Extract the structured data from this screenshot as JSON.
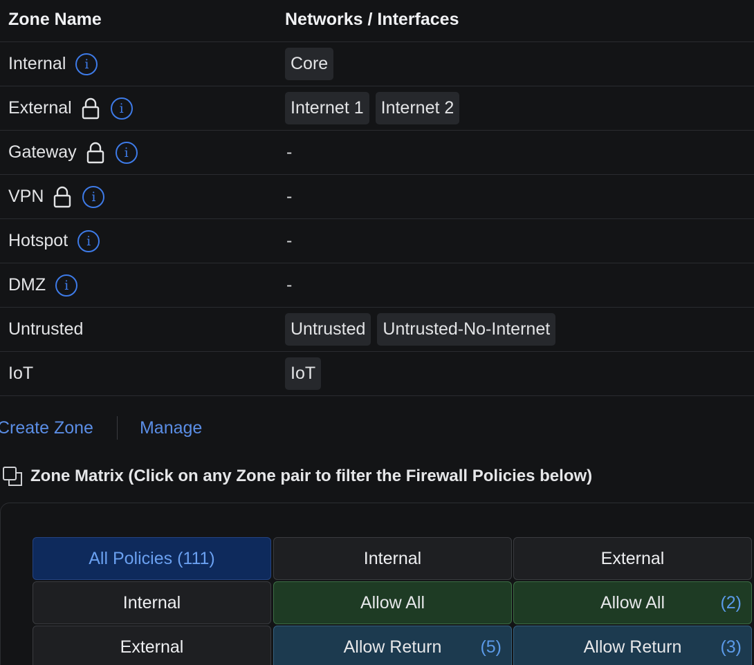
{
  "zone_table": {
    "headers": {
      "zone_name": "Zone Name",
      "networks": "Networks / Interfaces"
    },
    "rows": [
      {
        "name": "Internal",
        "locked": false,
        "info": true,
        "networks": [
          "Core"
        ]
      },
      {
        "name": "External",
        "locked": true,
        "info": true,
        "networks": [
          "Internet 1",
          "Internet 2"
        ]
      },
      {
        "name": "Gateway",
        "locked": true,
        "info": true,
        "networks": [],
        "empty": "-"
      },
      {
        "name": "VPN",
        "locked": true,
        "info": true,
        "networks": [],
        "empty": "-"
      },
      {
        "name": "Hotspot",
        "locked": false,
        "info": true,
        "networks": [],
        "empty": "-"
      },
      {
        "name": "DMZ",
        "locked": false,
        "info": true,
        "networks": [],
        "empty": "-"
      },
      {
        "name": "Untrusted",
        "locked": false,
        "info": false,
        "networks": [
          "Untrusted",
          "Untrusted-No-Internet"
        ]
      },
      {
        "name": "IoT",
        "locked": false,
        "info": false,
        "networks": [
          "IoT"
        ]
      }
    ]
  },
  "actions": {
    "create_zone": "Create Zone",
    "manage": "Manage"
  },
  "matrix": {
    "title": "Zone Matrix (Click on any Zone pair to filter the Firewall Policies below)",
    "all_policies": "All Policies (111)",
    "columns": [
      "Internal",
      "External"
    ],
    "rows": [
      {
        "label": "Internal",
        "cells": [
          {
            "text": "Allow All",
            "count": "",
            "kind": "green"
          },
          {
            "text": "Allow All",
            "count": "(2)",
            "kind": "green"
          }
        ]
      },
      {
        "label": "External",
        "cells": [
          {
            "text": "Allow Return",
            "count": "(5)",
            "kind": "blue"
          },
          {
            "text": "Allow Return",
            "count": "(3)",
            "kind": "blue"
          }
        ]
      }
    ]
  },
  "icons": {
    "info": "info-icon",
    "lock": "lock-icon",
    "matrix": "copy-icon"
  },
  "colors": {
    "link": "#5b8ee6",
    "info": "#3e7be8",
    "allow_all": "#1e3b24",
    "allow_return": "#1c3a4f",
    "all_policies": "#0e2a5c"
  }
}
